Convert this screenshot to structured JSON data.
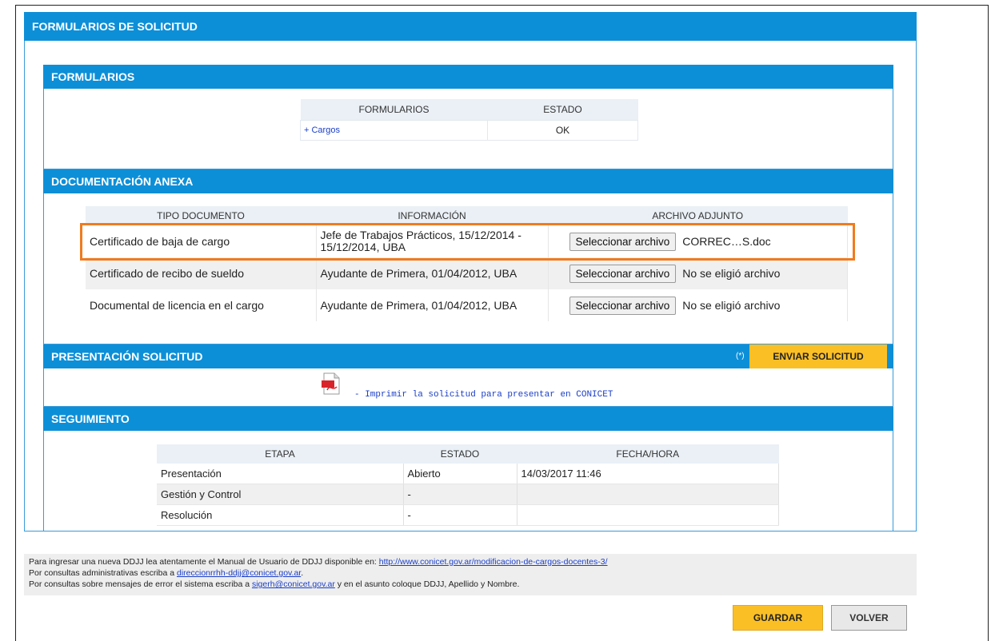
{
  "main": {
    "title": "FORMULARIOS DE SOLICITUD"
  },
  "formularios": {
    "title": "FORMULARIOS",
    "columns": [
      "FORMULARIOS",
      "ESTADO"
    ],
    "rows": [
      {
        "name": "+ Cargos",
        "estado": "OK"
      }
    ]
  },
  "documentacion": {
    "title": "DOCUMENTACIÓN ANEXA",
    "columns": [
      "TIPO DOCUMENTO",
      "INFORMACIÓN",
      "ARCHIVO ADJUNTO"
    ],
    "rows": [
      {
        "tipo": "Certificado de baja de cargo",
        "info": "Jefe de Trabajos Prácticos, 15/12/2014 - 15/12/2014, UBA",
        "button": "Seleccionar archivo",
        "file": "CORREC…S.doc"
      },
      {
        "tipo": "Certificado de recibo de sueldo",
        "info": "Ayudante de Primera, 01/04/2012, UBA",
        "button": "Seleccionar archivo",
        "file": "No se eligió archivo"
      },
      {
        "tipo": "Documental de licencia en el cargo",
        "info": "Ayudante de Primera, 01/04/2012, UBA",
        "button": "Seleccionar archivo",
        "file": "No se eligió archivo"
      }
    ]
  },
  "presentacion": {
    "title": "PRESENTACIÓN SOLICITUD",
    "note": "(*)",
    "send_label": "ENVIAR SOLICITUD",
    "print_link": "- Imprimir la solicitud para presentar en CONICET"
  },
  "seguimiento": {
    "title": "SEGUIMIENTO",
    "columns": [
      "ETAPA",
      "ESTADO",
      "FECHA/HORA"
    ],
    "rows": [
      {
        "etapa": "Presentación",
        "estado": "Abierto",
        "fecha": "14/03/2017 11:46"
      },
      {
        "etapa": "Gestión y Control",
        "estado": "-",
        "fecha": ""
      },
      {
        "etapa": "Resolución",
        "estado": "-",
        "fecha": ""
      }
    ]
  },
  "footer": {
    "line1_text": "Para ingresar una nueva DDJJ lea atentamente el Manual de Usuario de DDJJ disponible en: ",
    "line1_link": "http://www.conicet.gov.ar/modificacion-de-cargos-docentes-3/",
    "line2_text": "Por consultas administrativas escriba a ",
    "line2_link": "direccionrrhh-ddjj@conicet.gov.ar",
    "line2_end": ".",
    "line3_text": "Por consultas sobre mensajes de error el sistema escriba a ",
    "line3_link": "sigerh@conicet.gov.ar",
    "line3_end": " y en el asunto coloque DDJJ, Apellido y Nombre."
  },
  "actions": {
    "save_label": "GUARDAR",
    "back_label": "VOLVER"
  },
  "colors": {
    "header_blue": "#0d8fd8",
    "send_yellow": "#fbbf26",
    "highlight_orange": "#f07b1f"
  }
}
